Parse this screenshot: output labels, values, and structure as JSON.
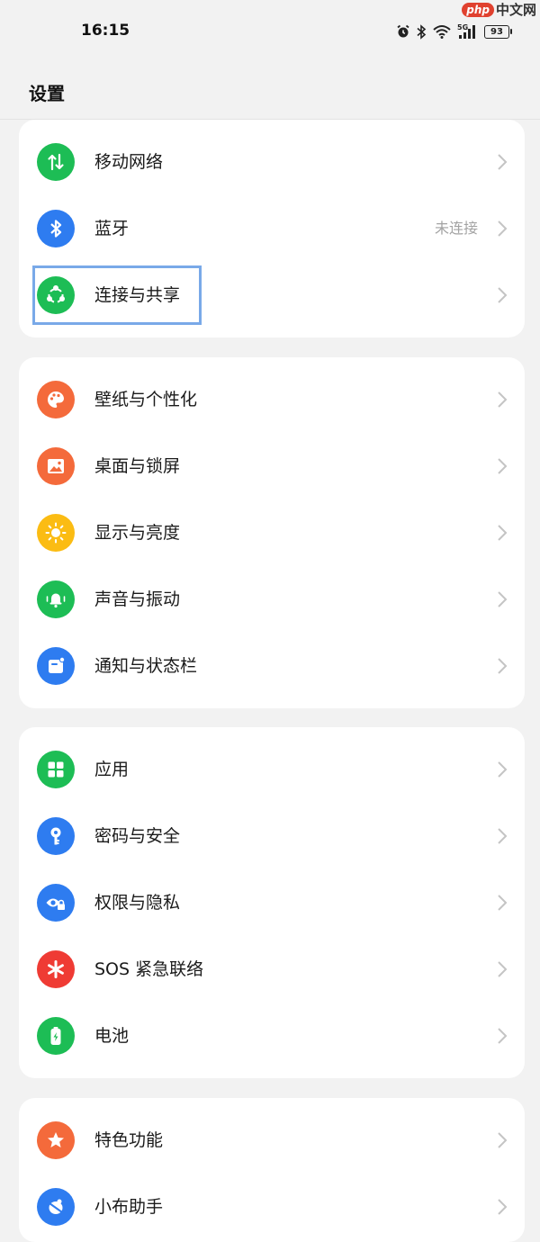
{
  "status_bar": {
    "time": "16:15",
    "battery": "93",
    "icons": [
      "alarm-icon",
      "bluetooth-icon",
      "wifi-icon",
      "5g-signal-icon",
      "battery-icon"
    ]
  },
  "watermark": {
    "brand": "php",
    "suffix": "中文网"
  },
  "header": {
    "title": "设置"
  },
  "groups": [
    {
      "items": [
        {
          "label": "移动网络",
          "icon": "mobile-network-icon",
          "color": "#1dbd55"
        },
        {
          "label": "蓝牙",
          "icon": "bluetooth-icon",
          "color": "#2e7cf0",
          "value": "未连接"
        },
        {
          "label": "连接与共享",
          "icon": "share-icon",
          "color": "#1dbd55"
        }
      ]
    },
    {
      "items": [
        {
          "label": "壁纸与个性化",
          "icon": "palette-icon",
          "color": "#f46a3b"
        },
        {
          "label": "桌面与锁屏",
          "icon": "image-icon",
          "color": "#f46a3b"
        },
        {
          "label": "显示与亮度",
          "icon": "sun-icon",
          "color": "#fbbc13"
        },
        {
          "label": "声音与振动",
          "icon": "bell-icon",
          "color": "#1dbd55"
        },
        {
          "label": "通知与状态栏",
          "icon": "notification-icon",
          "color": "#2e7cf0"
        }
      ]
    },
    {
      "items": [
        {
          "label": "应用",
          "icon": "apps-grid-icon",
          "color": "#1dbd55"
        },
        {
          "label": "密码与安全",
          "icon": "key-icon",
          "color": "#2e7cf0"
        },
        {
          "label": "权限与隐私",
          "icon": "privacy-eye-icon",
          "color": "#2e7cf0"
        },
        {
          "label": "SOS 紧急联络",
          "icon": "sos-asterisk-icon",
          "color": "#ef3b34"
        },
        {
          "label": "电池",
          "icon": "battery-charge-icon",
          "color": "#1dbd55"
        }
      ]
    },
    {
      "items": [
        {
          "label": "特色功能",
          "icon": "star-icon",
          "color": "#f46a3b"
        },
        {
          "label": "小布助手",
          "icon": "assistant-icon",
          "color": "#2e7cf0"
        }
      ]
    }
  ]
}
